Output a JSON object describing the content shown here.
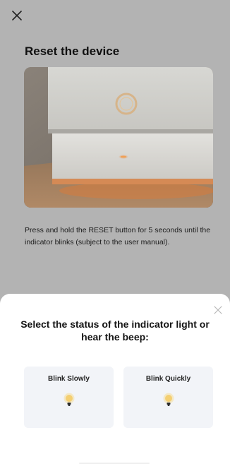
{
  "header": {
    "close_icon": "close-icon",
    "title": "Reset the device"
  },
  "image": {
    "description_icon": "device-photo"
  },
  "instruction": {
    "text": "Press and hold the RESET button for 5 seconds until the indicator blinks (subject to the user manual)."
  },
  "sheet": {
    "close_icon": "close-icon",
    "title": "Select the status of the indicator light or hear the beep:",
    "options": [
      {
        "label": "Blink Slowly",
        "icon": "bulb-icon"
      },
      {
        "label": "Blink Quickly",
        "icon": "bulb-icon"
      }
    ]
  },
  "colors": {
    "overlay": "#b3b3b3",
    "sheet": "#ffffff",
    "option_bg": "#f2f4f8",
    "bulb_glow": "#f6d98a"
  }
}
